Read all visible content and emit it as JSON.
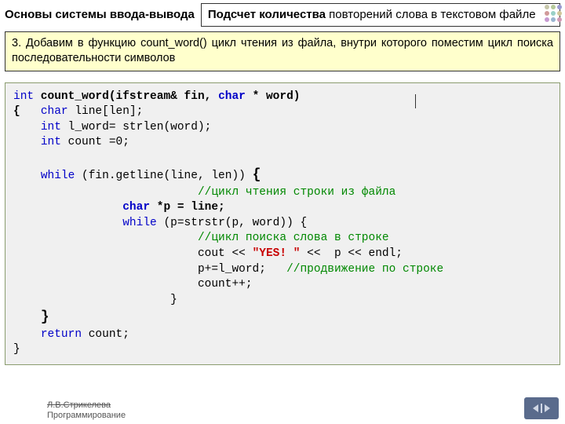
{
  "header": {
    "breadcrumb": "Основы системы ввода-вывода",
    "title_bold": "Подсчет количества",
    "title_rest": " повторений слова в текстовом файле"
  },
  "step": {
    "text": "3. Добавим в функцию count_word() цикл чтения из файла, внутри которого поместим цикл поиска последовательности символов"
  },
  "code": {
    "l1a": "int",
    "l1b": " count_word(ifstream& fin, ",
    "l1c": "char",
    "l1d": " * word)",
    "l2a": "{   ",
    "l2b": "char",
    "l2c": " line[len];",
    "l3a": "    ",
    "l3b": "int",
    "l3c": " l_word= strlen(word);",
    "l4a": "    ",
    "l4b": "int",
    "l4c": " count =0;",
    "l5a": "    ",
    "l5b": "while",
    "l5c": " (fin.getline(line, len)) ",
    "l5d": "{",
    "l6a": "                           ",
    "l6b": "//цикл чтения строки из файла",
    "l7a": "                ",
    "l7b": "char",
    "l7c": " *p = line;",
    "l8a": "                ",
    "l8b": "while",
    "l8c": " (p=strstr(p, word)) {",
    "l9a": "                           ",
    "l9b": "//цикл поиска слова в строке",
    "l10a": "                           cout << ",
    "l10b": "\"YES! \"",
    "l10c": " <<  p << endl;",
    "l11a": "                           p+=l_word;   ",
    "l11b": "//продвижение по строке",
    "l12a": "                           count++;",
    "l13a": "                       }",
    "l14a": "    ",
    "l14b": "}",
    "l15a": "    ",
    "l15b": "return",
    "l15c": " count;",
    "l16a": "}"
  },
  "footer": {
    "author": "Л.В.Стрикелева",
    "course": "Программирование"
  },
  "dots": {
    "colors": [
      "#c7c7aa",
      "#b5c99a",
      "#9a9ad1",
      "#d19a9a",
      "#9ad1c7",
      "#d1c79a",
      "#c79ad1",
      "#9ab5d1",
      "#d19ab5"
    ]
  }
}
